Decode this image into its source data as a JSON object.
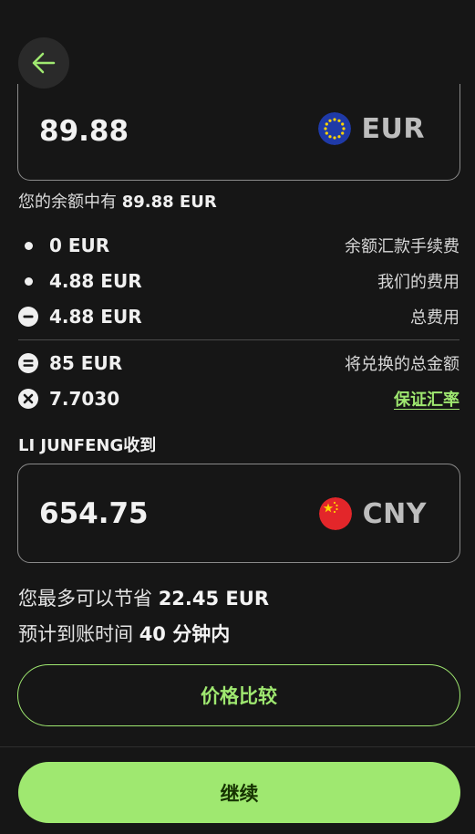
{
  "header": {
    "back_icon": "arrow-left-icon"
  },
  "send": {
    "amount": "89.88",
    "currency": "EUR",
    "flag_icon": "eu-flag-icon"
  },
  "balance": {
    "prefix": "您的余额中有 ",
    "value": "89.88 EUR"
  },
  "fees": [
    {
      "icon": "bullet-icon",
      "amount": "0 EUR",
      "label": "余额汇款手续费"
    },
    {
      "icon": "bullet-icon",
      "amount": "4.88 EUR",
      "label": "我们的费用"
    },
    {
      "icon": "minus-circle-icon",
      "amount": "4.88 EUR",
      "label": "总费用"
    },
    {
      "icon": "equals-circle-icon",
      "amount": "85 EUR",
      "label": "将兑换的总金额"
    },
    {
      "icon": "times-circle-icon",
      "amount": "7.7030",
      "label": "保证汇率"
    }
  ],
  "receive": {
    "label": "LI JUNFENG收到",
    "amount": "654.75",
    "currency": "CNY",
    "flag_icon": "china-flag-icon"
  },
  "savings": {
    "prefix": "您最多可以节省 ",
    "value": "22.45 EUR"
  },
  "eta": {
    "prefix": "预计到账时间 ",
    "value": "40 分钟内"
  },
  "buttons": {
    "compare": "价格比较",
    "continue": "继续"
  },
  "colors": {
    "background": "#161616",
    "accent": "#9fe870",
    "button_text": "#163300"
  }
}
